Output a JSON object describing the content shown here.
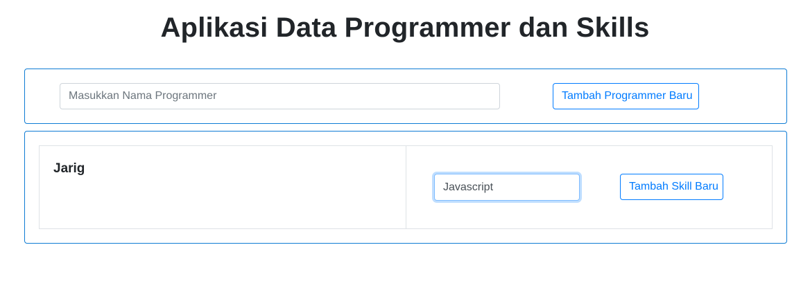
{
  "app": {
    "title": "Aplikasi Data Programmer dan Skills"
  },
  "add_programmer": {
    "input_placeholder": "Masukkan Nama Programmer",
    "input_value": "",
    "button_label": "Tambah Programmer Baru"
  },
  "programmers": [
    {
      "name": "Jarig",
      "skill_input_value": "Javascript",
      "add_skill_label": "Tambah Skill Baru"
    }
  ],
  "colors": {
    "primary": "#007bff",
    "card_border": "#0d7bd4",
    "text": "#212529",
    "border": "#dee2e6"
  }
}
